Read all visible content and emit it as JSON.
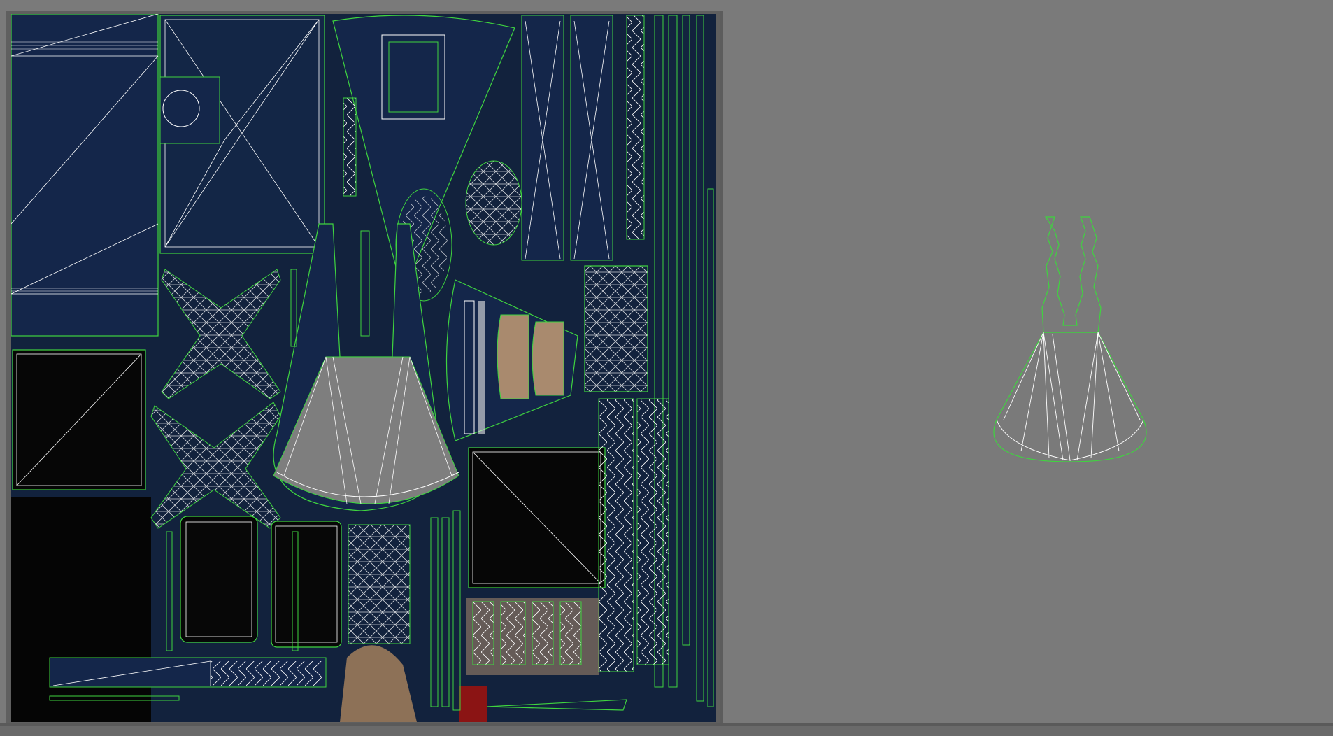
{
  "editor": {
    "title": "",
    "uv_panel": "texture-uv-layout",
    "preview_panel": "selected-uv-shell-preview"
  },
  "colors": {
    "viewport_background": "#7a7a7a",
    "texture_base": "#0f1d35",
    "uv_edge": "#3fd43f",
    "uv_wire": "#ffffff",
    "dark_fill": "#060606",
    "gray_fill": "#7e7e7e",
    "skin_fill": "#a98a6e",
    "accent_red": "#8b1414"
  },
  "icons": [
    "uv-wireframe-icon"
  ]
}
